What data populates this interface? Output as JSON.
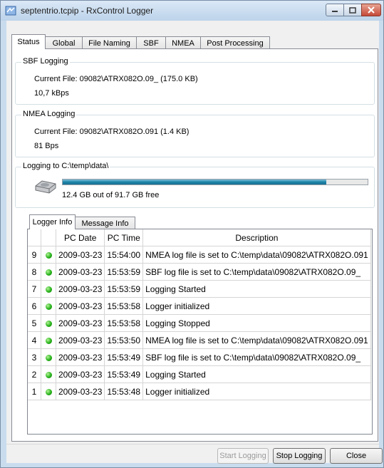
{
  "window": {
    "title": "septentrio.tcpip - RxControl Logger"
  },
  "tabs": [
    "Status",
    "Global",
    "File Naming",
    "SBF",
    "NMEA",
    "Post Processing"
  ],
  "sbf": {
    "label": "SBF Logging",
    "file_line": "Current File:  09082\\ATRX082O.09_  (175.0 KB)",
    "rate": "10,7 kBps"
  },
  "nmea": {
    "label": "NMEA Logging",
    "file_line": "Current File:  09082\\ATRX082O.091  (1.4 KB)",
    "rate": "81 Bps"
  },
  "disk": {
    "label": "Logging to C:\\temp\\data\\",
    "free_text": "12.4 GB out of 91.7 GB free",
    "used_fraction": 0.865
  },
  "subtabs": [
    "Logger Info",
    "Message Info"
  ],
  "table": {
    "columns": [
      "",
      "",
      "PC Date",
      "PC Time",
      "Description"
    ],
    "rows": [
      {
        "num": "9",
        "date": "2009-03-23",
        "time": "15:54:00",
        "desc": "NMEA log file is set to C:\\temp\\data\\09082\\ATRX082O.091"
      },
      {
        "num": "8",
        "date": "2009-03-23",
        "time": "15:53:59",
        "desc": "SBF log file is set to C:\\temp\\data\\09082\\ATRX082O.09_"
      },
      {
        "num": "7",
        "date": "2009-03-23",
        "time": "15:53:59",
        "desc": "Logging Started"
      },
      {
        "num": "6",
        "date": "2009-03-23",
        "time": "15:53:58",
        "desc": "Logger initialized"
      },
      {
        "num": "5",
        "date": "2009-03-23",
        "time": "15:53:58",
        "desc": "Logging Stopped"
      },
      {
        "num": "4",
        "date": "2009-03-23",
        "time": "15:53:50",
        "desc": "NMEA log file is set to C:\\temp\\data\\09082\\ATRX082O.091"
      },
      {
        "num": "3",
        "date": "2009-03-23",
        "time": "15:53:49",
        "desc": "SBF log file is set to C:\\temp\\data\\09082\\ATRX082O.09_"
      },
      {
        "num": "2",
        "date": "2009-03-23",
        "time": "15:53:49",
        "desc": "Logging Started"
      },
      {
        "num": "1",
        "date": "2009-03-23",
        "time": "15:53:48",
        "desc": "Logger initialized"
      }
    ]
  },
  "buttons": {
    "start": "Start Logging",
    "stop": "Stop Logging",
    "close": "Close"
  }
}
